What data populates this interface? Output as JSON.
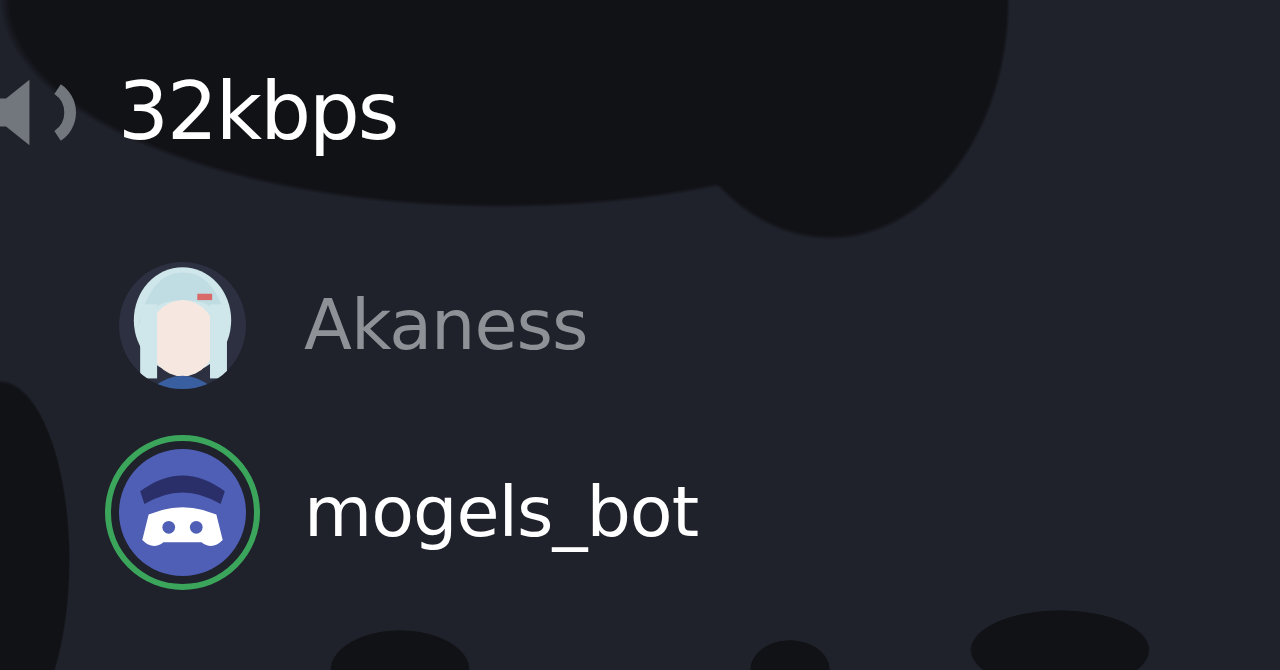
{
  "channel": {
    "name": "32kbps"
  },
  "members": [
    {
      "name": "Akaness",
      "kind": "picture",
      "speaking": false
    },
    {
      "name": "mogels_bot",
      "kind": "bot",
      "speaking": true
    }
  ]
}
